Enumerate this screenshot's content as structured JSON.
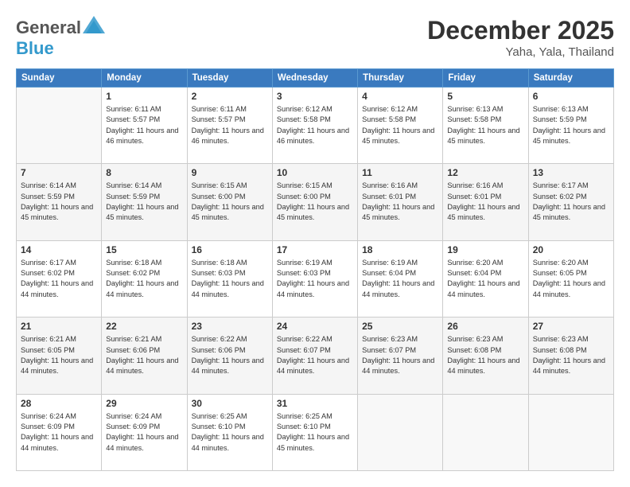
{
  "header": {
    "logo_general": "General",
    "logo_blue": "Blue",
    "month_title": "December 2025",
    "location": "Yaha, Yala, Thailand"
  },
  "weekdays": [
    "Sunday",
    "Monday",
    "Tuesday",
    "Wednesday",
    "Thursday",
    "Friday",
    "Saturday"
  ],
  "weeks": [
    [
      {
        "day": "",
        "empty": true
      },
      {
        "day": "1",
        "sunrise": "Sunrise: 6:11 AM",
        "sunset": "Sunset: 5:57 PM",
        "daylight": "Daylight: 11 hours and 46 minutes."
      },
      {
        "day": "2",
        "sunrise": "Sunrise: 6:11 AM",
        "sunset": "Sunset: 5:57 PM",
        "daylight": "Daylight: 11 hours and 46 minutes."
      },
      {
        "day": "3",
        "sunrise": "Sunrise: 6:12 AM",
        "sunset": "Sunset: 5:58 PM",
        "daylight": "Daylight: 11 hours and 46 minutes."
      },
      {
        "day": "4",
        "sunrise": "Sunrise: 6:12 AM",
        "sunset": "Sunset: 5:58 PM",
        "daylight": "Daylight: 11 hours and 45 minutes."
      },
      {
        "day": "5",
        "sunrise": "Sunrise: 6:13 AM",
        "sunset": "Sunset: 5:58 PM",
        "daylight": "Daylight: 11 hours and 45 minutes."
      },
      {
        "day": "6",
        "sunrise": "Sunrise: 6:13 AM",
        "sunset": "Sunset: 5:59 PM",
        "daylight": "Daylight: 11 hours and 45 minutes."
      }
    ],
    [
      {
        "day": "7",
        "sunrise": "Sunrise: 6:14 AM",
        "sunset": "Sunset: 5:59 PM",
        "daylight": "Daylight: 11 hours and 45 minutes."
      },
      {
        "day": "8",
        "sunrise": "Sunrise: 6:14 AM",
        "sunset": "Sunset: 5:59 PM",
        "daylight": "Daylight: 11 hours and 45 minutes."
      },
      {
        "day": "9",
        "sunrise": "Sunrise: 6:15 AM",
        "sunset": "Sunset: 6:00 PM",
        "daylight": "Daylight: 11 hours and 45 minutes."
      },
      {
        "day": "10",
        "sunrise": "Sunrise: 6:15 AM",
        "sunset": "Sunset: 6:00 PM",
        "daylight": "Daylight: 11 hours and 45 minutes."
      },
      {
        "day": "11",
        "sunrise": "Sunrise: 6:16 AM",
        "sunset": "Sunset: 6:01 PM",
        "daylight": "Daylight: 11 hours and 45 minutes."
      },
      {
        "day": "12",
        "sunrise": "Sunrise: 6:16 AM",
        "sunset": "Sunset: 6:01 PM",
        "daylight": "Daylight: 11 hours and 45 minutes."
      },
      {
        "day": "13",
        "sunrise": "Sunrise: 6:17 AM",
        "sunset": "Sunset: 6:02 PM",
        "daylight": "Daylight: 11 hours and 45 minutes."
      }
    ],
    [
      {
        "day": "14",
        "sunrise": "Sunrise: 6:17 AM",
        "sunset": "Sunset: 6:02 PM",
        "daylight": "Daylight: 11 hours and 44 minutes."
      },
      {
        "day": "15",
        "sunrise": "Sunrise: 6:18 AM",
        "sunset": "Sunset: 6:02 PM",
        "daylight": "Daylight: 11 hours and 44 minutes."
      },
      {
        "day": "16",
        "sunrise": "Sunrise: 6:18 AM",
        "sunset": "Sunset: 6:03 PM",
        "daylight": "Daylight: 11 hours and 44 minutes."
      },
      {
        "day": "17",
        "sunrise": "Sunrise: 6:19 AM",
        "sunset": "Sunset: 6:03 PM",
        "daylight": "Daylight: 11 hours and 44 minutes."
      },
      {
        "day": "18",
        "sunrise": "Sunrise: 6:19 AM",
        "sunset": "Sunset: 6:04 PM",
        "daylight": "Daylight: 11 hours and 44 minutes."
      },
      {
        "day": "19",
        "sunrise": "Sunrise: 6:20 AM",
        "sunset": "Sunset: 6:04 PM",
        "daylight": "Daylight: 11 hours and 44 minutes."
      },
      {
        "day": "20",
        "sunrise": "Sunrise: 6:20 AM",
        "sunset": "Sunset: 6:05 PM",
        "daylight": "Daylight: 11 hours and 44 minutes."
      }
    ],
    [
      {
        "day": "21",
        "sunrise": "Sunrise: 6:21 AM",
        "sunset": "Sunset: 6:05 PM",
        "daylight": "Daylight: 11 hours and 44 minutes."
      },
      {
        "day": "22",
        "sunrise": "Sunrise: 6:21 AM",
        "sunset": "Sunset: 6:06 PM",
        "daylight": "Daylight: 11 hours and 44 minutes."
      },
      {
        "day": "23",
        "sunrise": "Sunrise: 6:22 AM",
        "sunset": "Sunset: 6:06 PM",
        "daylight": "Daylight: 11 hours and 44 minutes."
      },
      {
        "day": "24",
        "sunrise": "Sunrise: 6:22 AM",
        "sunset": "Sunset: 6:07 PM",
        "daylight": "Daylight: 11 hours and 44 minutes."
      },
      {
        "day": "25",
        "sunrise": "Sunrise: 6:23 AM",
        "sunset": "Sunset: 6:07 PM",
        "daylight": "Daylight: 11 hours and 44 minutes."
      },
      {
        "day": "26",
        "sunrise": "Sunrise: 6:23 AM",
        "sunset": "Sunset: 6:08 PM",
        "daylight": "Daylight: 11 hours and 44 minutes."
      },
      {
        "day": "27",
        "sunrise": "Sunrise: 6:23 AM",
        "sunset": "Sunset: 6:08 PM",
        "daylight": "Daylight: 11 hours and 44 minutes."
      }
    ],
    [
      {
        "day": "28",
        "sunrise": "Sunrise: 6:24 AM",
        "sunset": "Sunset: 6:09 PM",
        "daylight": "Daylight: 11 hours and 44 minutes."
      },
      {
        "day": "29",
        "sunrise": "Sunrise: 6:24 AM",
        "sunset": "Sunset: 6:09 PM",
        "daylight": "Daylight: 11 hours and 44 minutes."
      },
      {
        "day": "30",
        "sunrise": "Sunrise: 6:25 AM",
        "sunset": "Sunset: 6:10 PM",
        "daylight": "Daylight: 11 hours and 44 minutes."
      },
      {
        "day": "31",
        "sunrise": "Sunrise: 6:25 AM",
        "sunset": "Sunset: 6:10 PM",
        "daylight": "Daylight: 11 hours and 45 minutes."
      },
      {
        "day": "",
        "empty": true
      },
      {
        "day": "",
        "empty": true
      },
      {
        "day": "",
        "empty": true
      }
    ]
  ]
}
